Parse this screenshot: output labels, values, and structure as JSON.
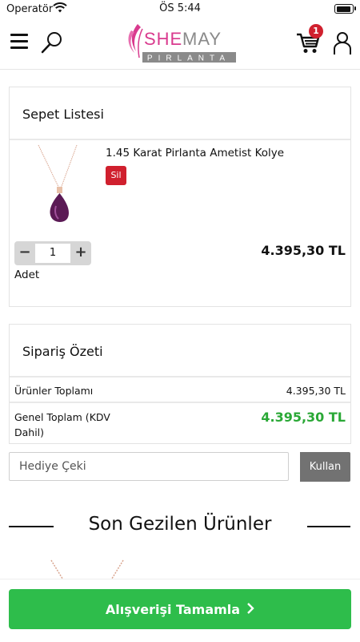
{
  "status_bar": {
    "carrier": "Operatör",
    "time": "ÖS 5:44"
  },
  "header": {
    "logo_text": "SHEMAY",
    "logo_subtext": "PIRLANTA",
    "cart_count": "1",
    "icons": [
      "menu-icon",
      "search-icon",
      "cart-icon",
      "user-icon"
    ]
  },
  "cart": {
    "title": "Sepet Listesi",
    "items": [
      {
        "name": "1.45 Karat Pirlanta Ametist Kolye",
        "delete_label": "Sil",
        "quantity": "1",
        "quantity_label": "Adet",
        "price": "4.395,30 TL"
      }
    ]
  },
  "summary": {
    "title": "Sipariş Özeti",
    "subtotal_label": "Ürünler Toplamı",
    "subtotal_value": "4.395,30 TL",
    "total_label": "Genel Toplam (KDV Dahil)",
    "total_value": "4.395,30 TL"
  },
  "gift": {
    "placeholder": "Hediye Çeki",
    "button_label": "Kullan"
  },
  "recent": {
    "title": "Son Gezilen Ürünler"
  },
  "checkout": {
    "label": "Alışverişi Tamamla"
  },
  "colors": {
    "accent_red": "#d0202e",
    "total_green": "#2aa836",
    "checkout_green": "#2ebd4b",
    "logo_pink": "#d93a8e"
  }
}
